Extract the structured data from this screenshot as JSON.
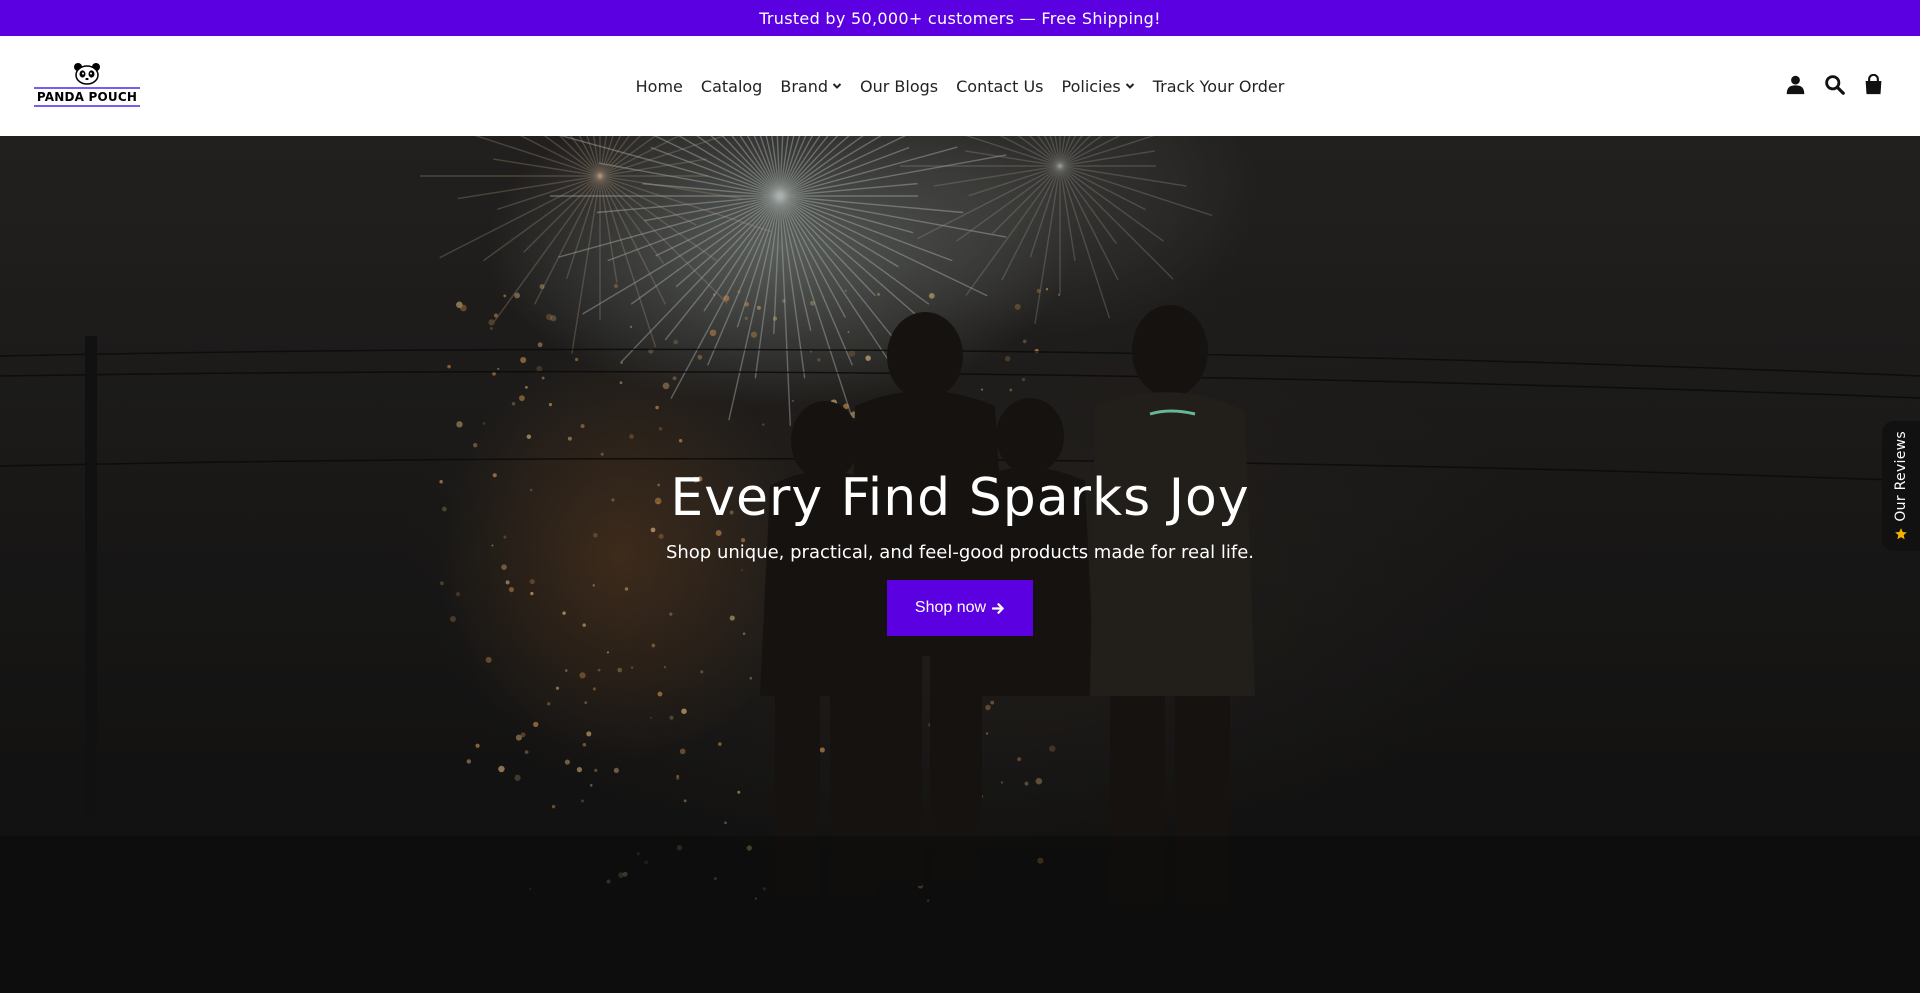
{
  "colors": {
    "accent": "#5b00e0",
    "logo_accent": "#7b5cf0",
    "header_bg": "#ffffff",
    "text_dark": "#222222",
    "star": "#f5b301"
  },
  "announcement": {
    "text": "Trusted by 50,000+ customers — Free Shipping!"
  },
  "header": {
    "logo_text": "PANDA POUCH",
    "nav": [
      {
        "label": "Home",
        "has_dropdown": false
      },
      {
        "label": "Catalog",
        "has_dropdown": false
      },
      {
        "label": "Brand",
        "has_dropdown": true
      },
      {
        "label": "Our Blogs",
        "has_dropdown": false
      },
      {
        "label": "Contact Us",
        "has_dropdown": false
      },
      {
        "label": "Policies",
        "has_dropdown": true
      },
      {
        "label": "Track Your Order",
        "has_dropdown": false
      }
    ],
    "icons": [
      "account-icon",
      "search-icon",
      "cart-icon"
    ]
  },
  "hero": {
    "title": "Every Find Sparks Joy",
    "subtitle": "Shop unique, practical, and feel-good products made for real life.",
    "button_label": "Shop now"
  },
  "reviews_tab": {
    "label": "Our Reviews"
  }
}
